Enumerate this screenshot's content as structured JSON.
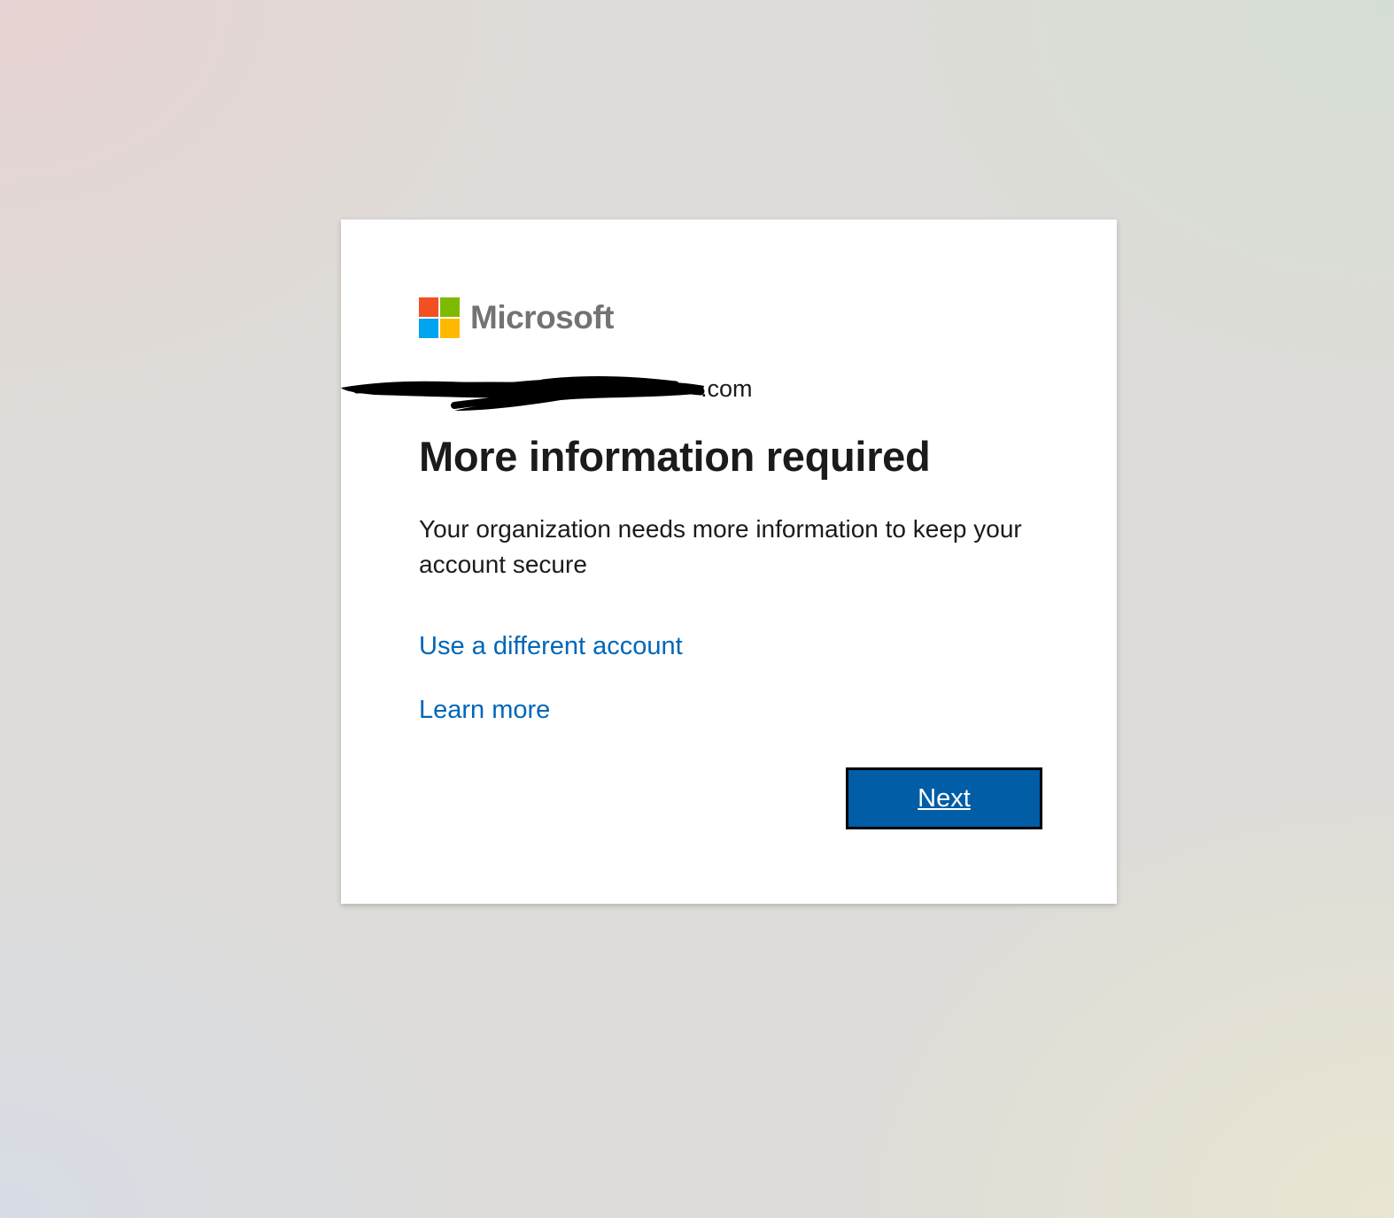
{
  "brand": {
    "name": "Microsoft",
    "logo_colors": [
      "#f25022",
      "#7fba00",
      "#00a4ef",
      "#ffb900"
    ]
  },
  "identity": {
    "email_visible_suffix": ".com"
  },
  "content": {
    "title": "More information required",
    "description": "Your organization needs more information to keep your account secure"
  },
  "links": {
    "different_account": "Use a different account",
    "learn_more": "Learn more"
  },
  "actions": {
    "next_label": "Next"
  },
  "colors": {
    "link": "#0067b8",
    "primary_button": "#005da6"
  }
}
